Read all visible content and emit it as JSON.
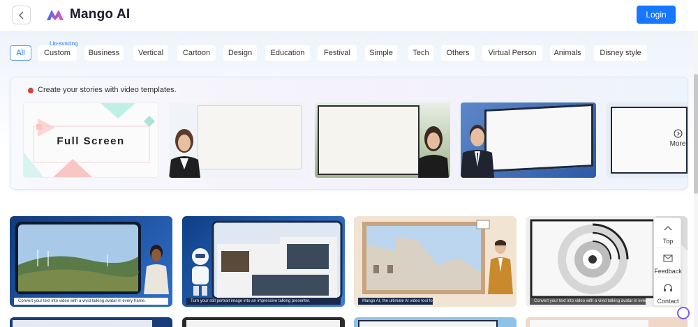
{
  "header": {
    "brand": "Mango AI",
    "login_label": "Login"
  },
  "tabs": {
    "items": [
      "All",
      "Custom",
      "Business",
      "Vertical",
      "Cartoon",
      "Design",
      "Education",
      "Festival",
      "Simple",
      "Tech",
      "Others",
      "Virtual Person",
      "Animals",
      "Disney style"
    ],
    "custom_tag": "Lip-syncing",
    "active": "All"
  },
  "banner": {
    "title": "Create your stories with video templates.",
    "template1_text": "Full Screen",
    "more_label": "More"
  },
  "videos": {
    "captions": [
      "Convert your text into video with a vivid talking avatar in every frame.",
      "Turn your still portrait image into an impressive talking presenter.",
      "Mango AI, the ultimate AI video tool for all you need.",
      "Convert your text into video with a vivid talking avatar in every frame."
    ]
  },
  "side": {
    "top_label": "Top",
    "feedback_label": "Feedback",
    "contact_label": "Contact"
  },
  "colors": {
    "accent": "#1677ff",
    "brand_gradient_start": "#3f6cff",
    "brand_gradient_end": "#ff4f9a"
  }
}
